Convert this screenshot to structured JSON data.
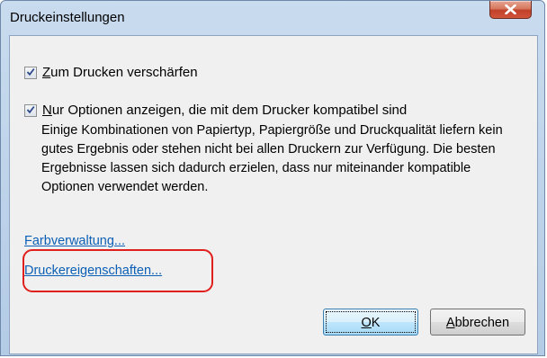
{
  "window": {
    "title": "Druckeinstellungen",
    "close_glyph": "X"
  },
  "options": [
    {
      "mnemonic": "Z",
      "label_rest": "um Drucken verschärfen",
      "checked": true
    },
    {
      "mnemonic": "N",
      "label_rest": "ur Optionen anzeigen, die mit dem Drucker kompatibel sind",
      "checked": true,
      "description": "Einige Kombinationen von Papiertyp, Papiergröße und Druckqualität liefern kein gutes Ergebnis oder stehen nicht bei allen Druckern zur Verfügung. Die besten Ergebnisse lassen sich dadurch erzielen, dass nur miteinander kompatible Optionen verwendet werden."
    }
  ],
  "links": {
    "color_management": "Farbverwaltung...",
    "printer_properties": "Druckereigenschaften..."
  },
  "buttons": {
    "ok_mnemonic": "O",
    "ok_rest": "K",
    "cancel_mnemonic": "A",
    "cancel_rest": "bbrechen"
  },
  "colors": {
    "link": "#0b5fb5",
    "highlight": "#e0201c",
    "close_button": "#c2402a"
  }
}
